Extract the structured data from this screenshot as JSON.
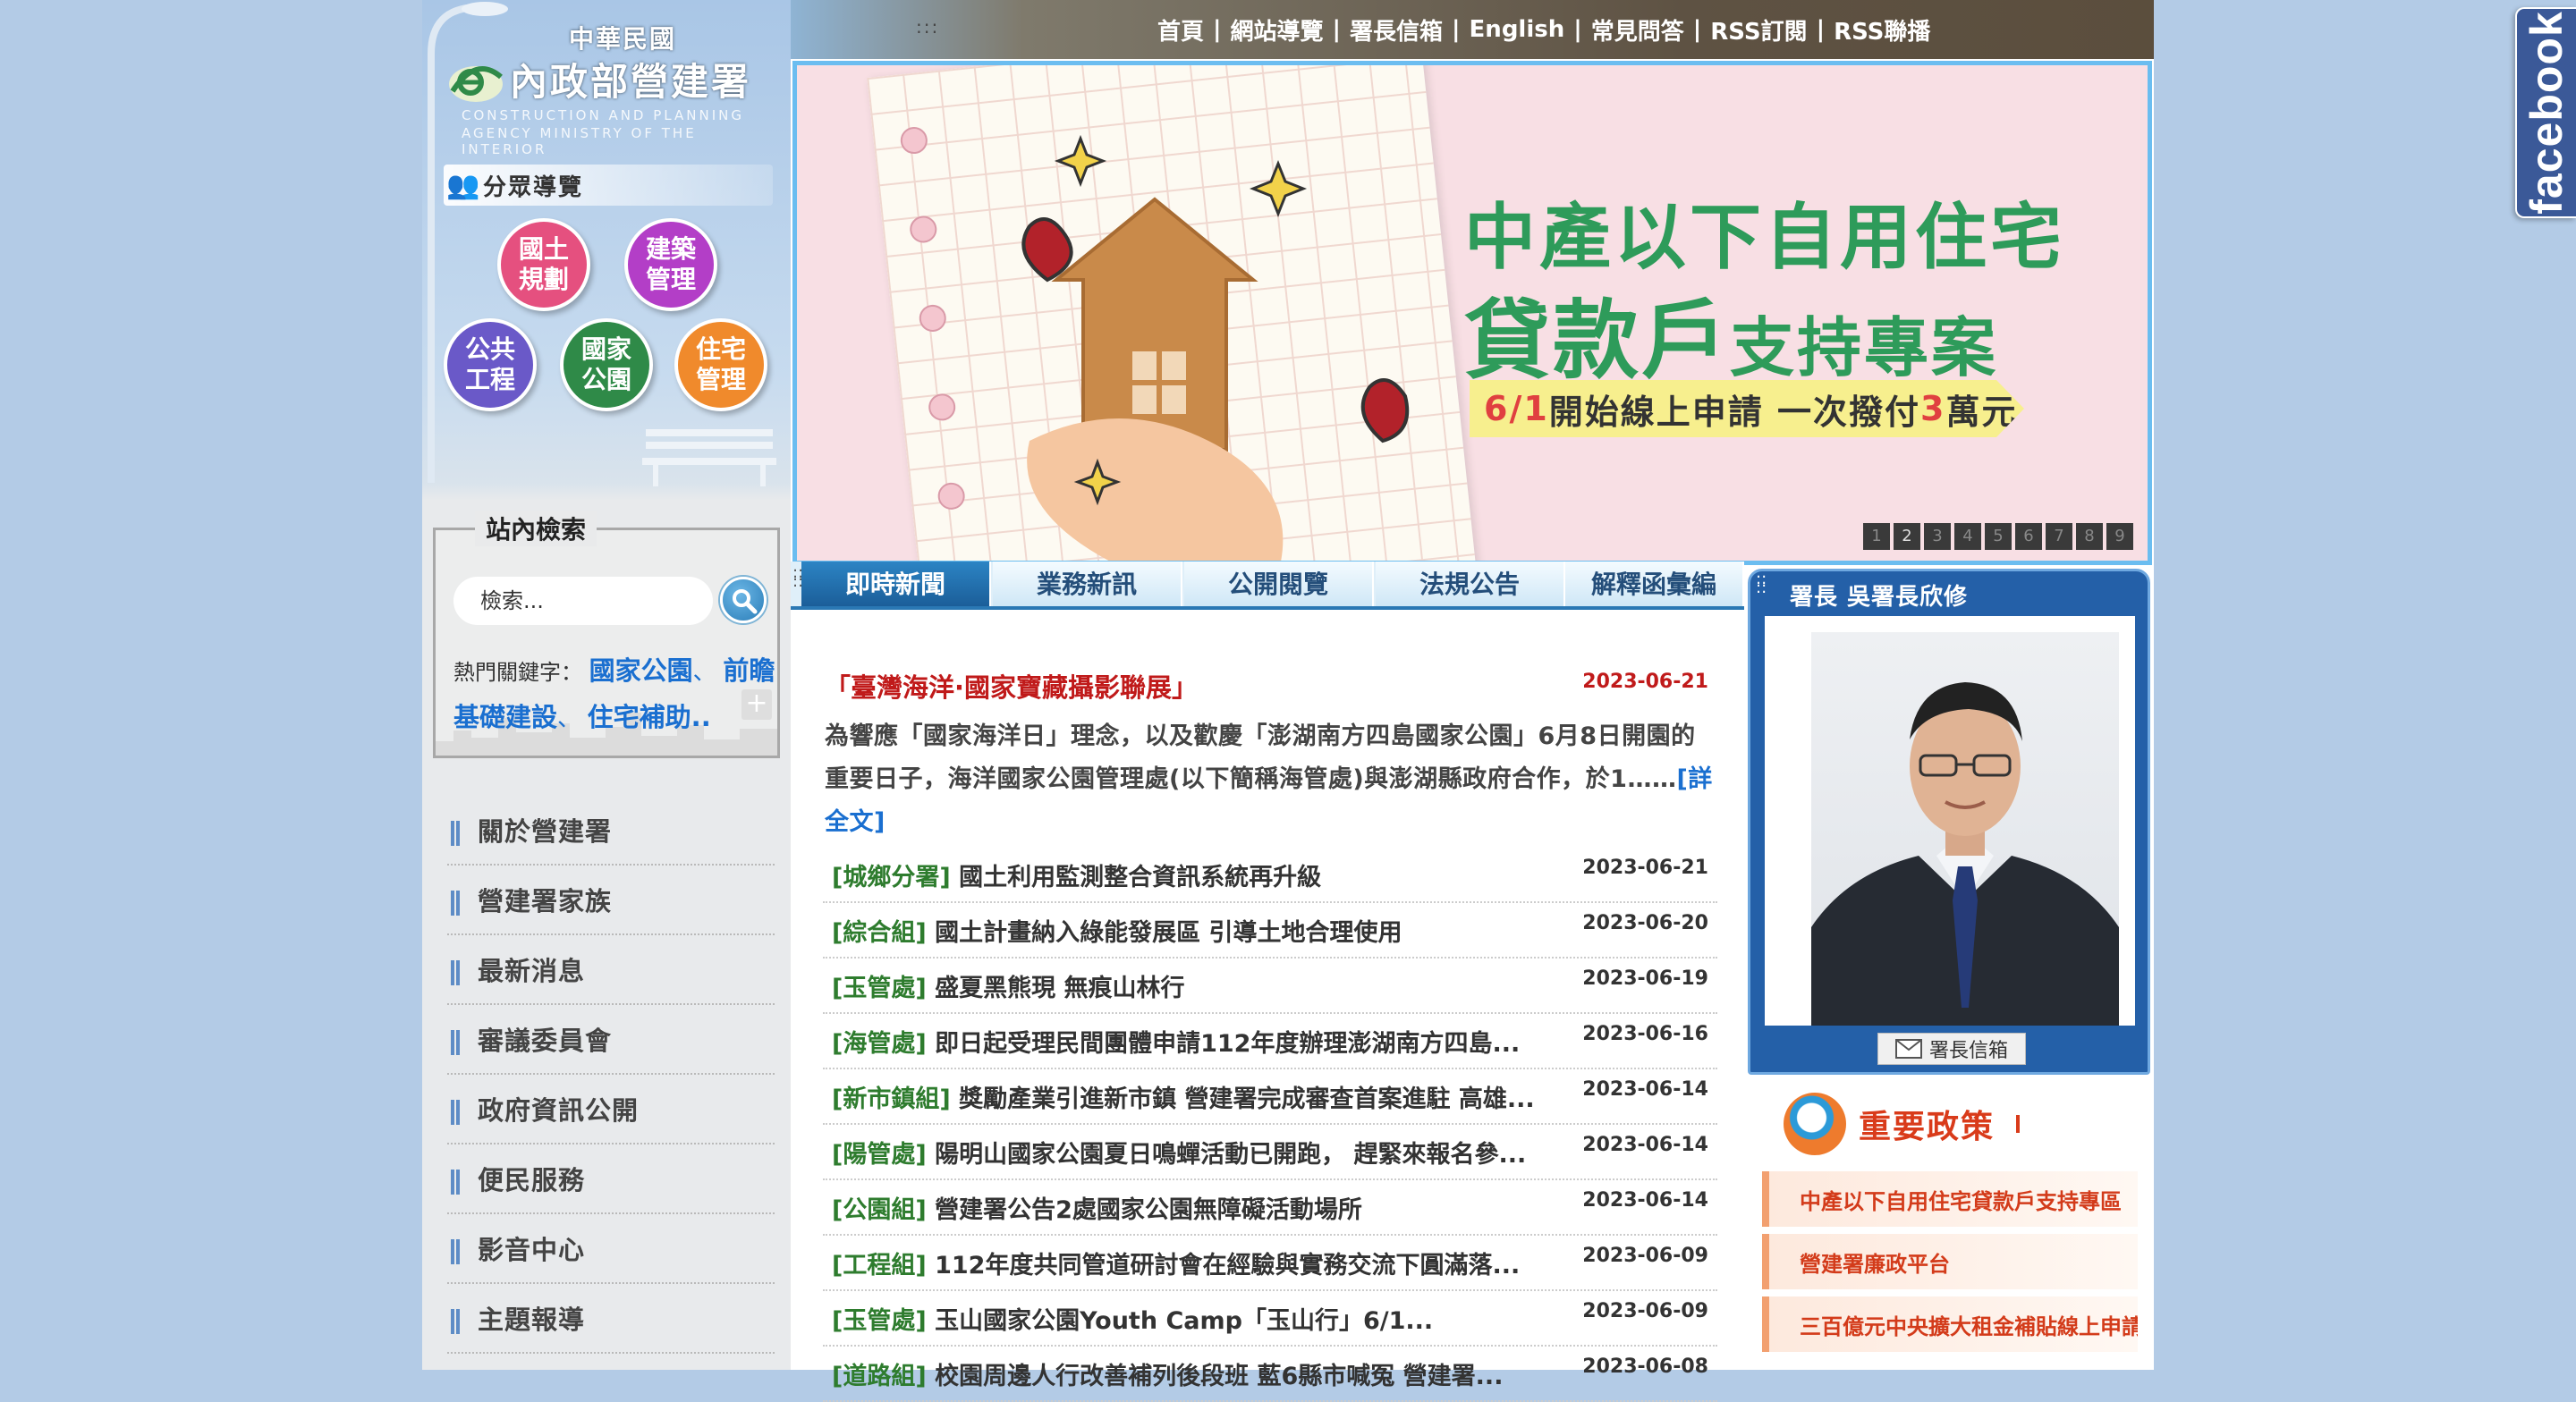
{
  "facebook": {
    "label": "facebook"
  },
  "logo": {
    "roc": "中華民國",
    "agency": "內政部營建署",
    "en_line1": "CONSTRUCTION AND PLANNING",
    "en_line2": "AGENCY MINISTRY OF THE INTERIOR"
  },
  "guide": {
    "title": "分眾導覽",
    "buttons": [
      {
        "label": "國土\n規劃",
        "color": "#e5507f"
      },
      {
        "label": "建築\n管理",
        "color": "#b33ec7"
      },
      {
        "label": "公共\n工程",
        "color": "#6a59c8"
      },
      {
        "label": "國家\n公園",
        "color": "#2f8a48"
      },
      {
        "label": "住宅\n管理",
        "color": "#f08a2c"
      }
    ]
  },
  "search": {
    "legend": "站內檢索",
    "placeholder": "檢索...",
    "hot_label": "熱門關鍵字：",
    "keywords": [
      "國家公園",
      "前瞻基礎建設",
      "住宅補助.."
    ],
    "more": "+"
  },
  "left_nav": {
    "items": [
      "關於營建署",
      "營建署家族",
      "最新消息",
      "審議委員會",
      "政府資訊公開",
      "便民服務",
      "影音中心",
      "主題報導"
    ]
  },
  "top_links": [
    "首頁",
    "網站導覽",
    "署長信箱",
    "English",
    "常見問答",
    "RSS訂閱",
    "RSS聯播"
  ],
  "banner": {
    "title1": "中產以下自用住宅",
    "title2_big": "貸款戶",
    "title2_small": "支持專案",
    "ribbon_date": "6/1",
    "ribbon_mid": "開始線上申請 一次撥付",
    "ribbon_num": "3",
    "ribbon_end": "萬元",
    "pages": [
      "1",
      "2",
      "3",
      "4",
      "5",
      "6",
      "7",
      "8",
      "9"
    ],
    "active_page": "2"
  },
  "news": {
    "tabs": [
      "即時新聞",
      "業務新訊",
      "公開閱覽",
      "法規公告",
      "解釋函彙編"
    ],
    "active_tab": "即時新聞",
    "headline": {
      "title": "「臺灣海洋·國家寶藏攝影聯展」",
      "date": "2023-06-21",
      "body": "為響應「國家海洋日」理念，以及歡慶「澎湖南方四島國家公園」6月8日開園的重要日子，海洋國家公園管理處(以下簡稱海管處)與澎湖縣政府合作，於1……",
      "more": "[詳全文]"
    },
    "rows": [
      {
        "unit": "[城鄉分署]",
        "title": "國土利用監測整合資訊系統再升級",
        "date": "2023-06-21"
      },
      {
        "unit": "[綜合組]",
        "title": "國土計畫納入綠能發展區 引導土地合理使用",
        "date": "2023-06-20"
      },
      {
        "unit": "[玉管處]",
        "title": "盛夏黑熊現 無痕山林行",
        "date": "2023-06-19"
      },
      {
        "unit": "[海管處]",
        "title": "即日起受理民間團體申請112年度辦理澎湖南方四島...",
        "date": "2023-06-16"
      },
      {
        "unit": "[新市鎮組]",
        "title": "獎勵產業引進新市鎮 營建署完成審查首案進駐 高雄...",
        "date": "2023-06-14"
      },
      {
        "unit": "[陽管處]",
        "title": "陽明山國家公園夏日鳴蟬活動已開跑， 趕緊來報名參...",
        "date": "2023-06-14"
      },
      {
        "unit": "[公園組]",
        "title": "營建署公告2處國家公園無障礙活動場所",
        "date": "2023-06-14"
      },
      {
        "unit": "[工程組]",
        "title": "112年度共同管道研討會在經驗與實務交流下圓滿落...",
        "date": "2023-06-09"
      },
      {
        "unit": "[玉管處]",
        "title": "玉山國家公園Youth Camp「玉山行」6/1...",
        "date": "2023-06-09"
      },
      {
        "unit": "[道路組]",
        "title": "校園周邊人行改善補列後段班 藍6縣市喊冤 營建署...",
        "date": "2023-06-08"
      }
    ]
  },
  "director": {
    "title": "署長 吳署長欣修",
    "mailbox": "署長信箱"
  },
  "policy": {
    "title": "重要政策",
    "items": [
      "中產以下自用住宅貸款戶支持專區",
      "營建署廉政平台",
      "三百億元中央擴大租金補貼線上申請"
    ]
  }
}
